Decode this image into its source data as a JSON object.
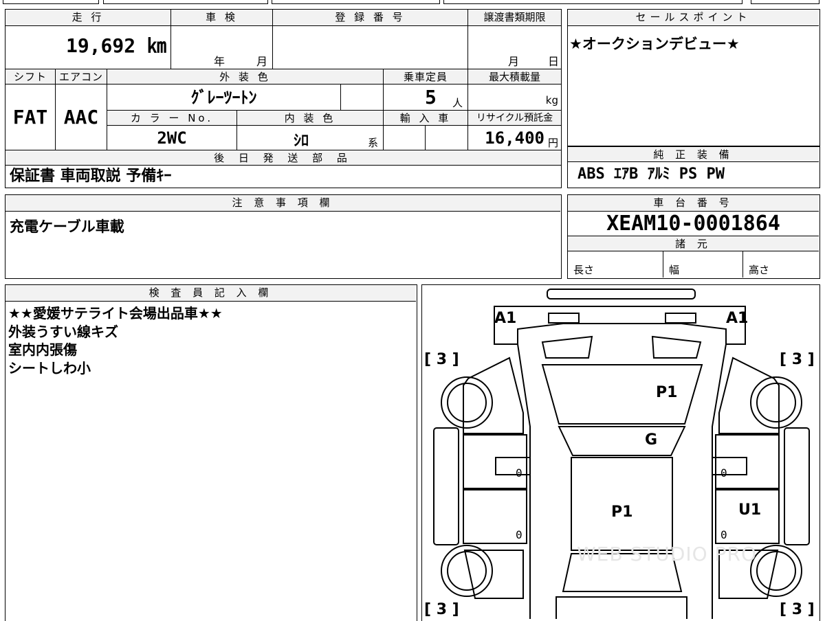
{
  "top_strip": {
    "partial_text": "…"
  },
  "vehicle_info": {
    "mileage_label": "走 行",
    "mileage_value": "19,692 ㎞",
    "inspection_label": "車 検",
    "inspection_year": "年",
    "inspection_month": "月",
    "registration_label": "登 録 番 号",
    "transfer_label": "譲渡書類期限",
    "transfer_month": "月",
    "transfer_day": "日",
    "shift_label": "シフト",
    "shift_value": "FAT",
    "ac_label": "エアコン",
    "ac_value": "AAC",
    "exterior_label": "外 装 色",
    "exterior_value": "ｸﾞﾚｰﾂｰﾄﾝ",
    "capacity_label": "乗車定員",
    "capacity_value": "5",
    "capacity_unit": "人",
    "load_label": "最大積載量",
    "load_unit": "kg",
    "color_no_label": "カ ラ ー No.",
    "color_no_value": "2WC",
    "interior_label": "内 装 色",
    "interior_value": "ｼﾛ",
    "interior_unit": "系",
    "import_label": "輸 入 車",
    "recycle_label": "リサイクル預託金",
    "recycle_value": "16,400",
    "recycle_unit": "円"
  },
  "sales_point": {
    "header": "セールスポイント",
    "text": "★オークションデビュー★"
  },
  "later_shipping": {
    "header": "後 日 発 送 部 品",
    "text": "保証書 車両取説 予備ｷｰ"
  },
  "standard_equipment": {
    "header": "純 正 装 備",
    "text": "ABS ｴｱB ｱﾙﾐ PS PW"
  },
  "notes": {
    "header": "注 意 事 項 欄",
    "text": "充電ケーブル車載"
  },
  "chassis": {
    "header": "車 台 番 号",
    "value": "XEAM10-0001864",
    "specs_header": "諸 元",
    "length_label": "長さ",
    "width_label": "幅",
    "height_label": "高さ"
  },
  "inspector": {
    "header": "検 査 員 記 入 欄",
    "lines": [
      "★★愛媛サテライト会場出品車★★",
      "外装うすい線キズ",
      "室内内張傷",
      "シートしわ小"
    ]
  },
  "diagram": {
    "marks": {
      "a1_left": "A1",
      "a1_right": "A1",
      "tire_tl": "[ 3 ]",
      "tire_tr": "[ 3 ]",
      "tire_bl": "[ 3 ]",
      "tire_br": "[ 3 ]",
      "hood": "P1",
      "windshield": "G",
      "roof": "P1",
      "right_door": "U1",
      "zero_1": "0",
      "zero_2": "0",
      "zero_3": "0",
      "zero_4": "0"
    },
    "watermark": "WEB STUDIO PRO"
  }
}
